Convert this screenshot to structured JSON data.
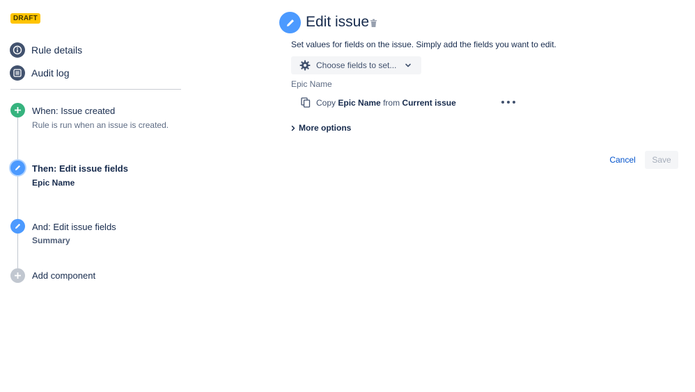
{
  "status_badge": "DRAFT",
  "nav": {
    "rule_details": "Rule details",
    "audit_log": "Audit log"
  },
  "steps": [
    {
      "prefix": "When:",
      "title": "Issue created",
      "subtitle": "Rule is run when an issue is created.",
      "type": "trigger",
      "color": "#36b37e"
    },
    {
      "title": "Then: Edit issue fields",
      "subtitle": "Epic Name",
      "type": "action",
      "active": true,
      "color": "#4c9aff"
    },
    {
      "title": "And: Edit issue fields",
      "subtitle": "Summary",
      "type": "action",
      "color": "#4c9aff"
    }
  ],
  "add_component": "Add component",
  "panel": {
    "title": "Edit issue",
    "description": "Set values for fields on the issue. Simply add the fields you want to edit.",
    "choose_fields": "Choose fields to set...",
    "field_label": "Epic Name",
    "copy_row": {
      "verb": "Copy",
      "field": "Epic Name",
      "from": "from",
      "source": "Current issue"
    },
    "more_options": "More options",
    "cancel": "Cancel",
    "save": "Save"
  },
  "colors": {
    "accent": "#0052cc",
    "trigger_green": "#36b37e",
    "action_blue": "#4c9aff",
    "badge_yellow": "#ffc400",
    "nav_icon": "#42526e"
  },
  "icons": [
    "info-icon",
    "list-icon",
    "plus-icon",
    "pencil-icon",
    "trash-icon",
    "gear-icon",
    "chevron-down-icon",
    "copy-icon",
    "more-icon",
    "chevron-right-icon"
  ]
}
